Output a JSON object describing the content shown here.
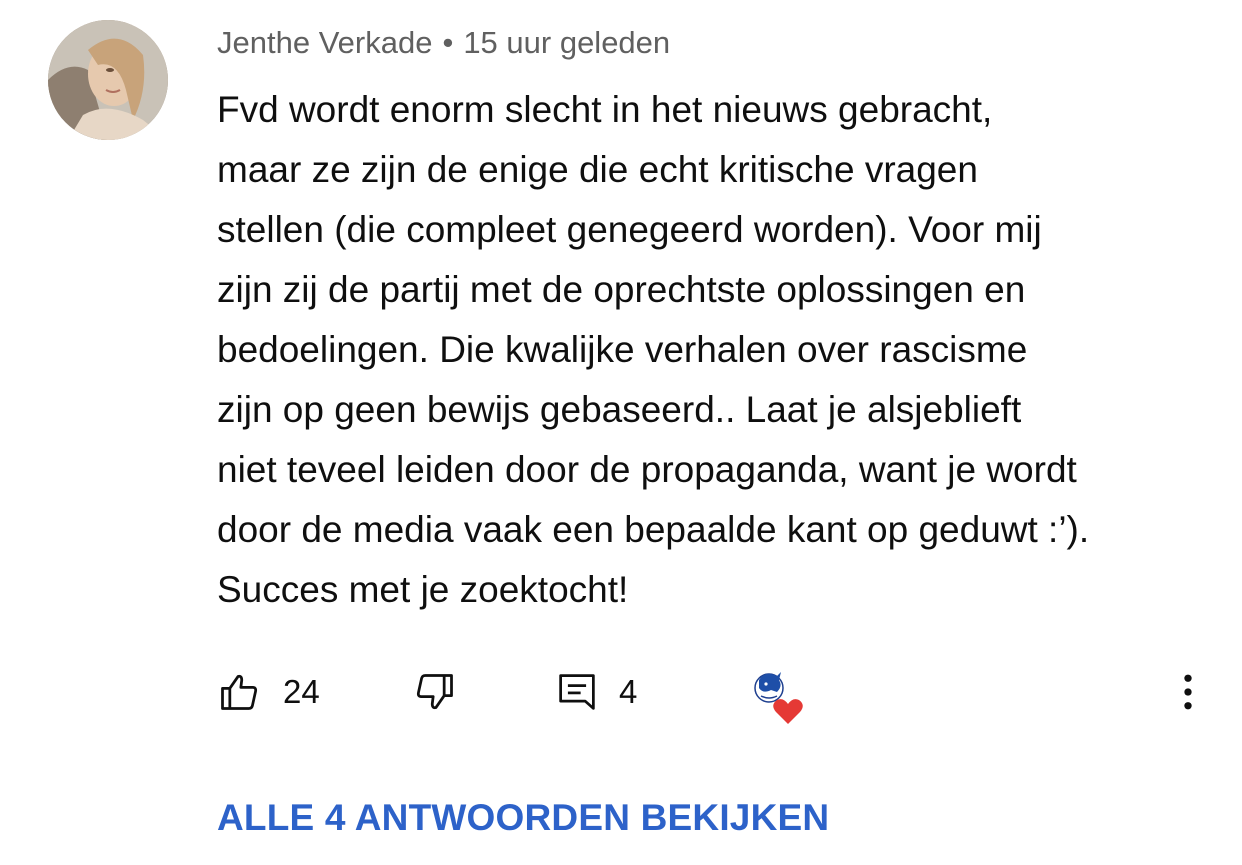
{
  "comment": {
    "author": "Jenthe Verkade",
    "separator": "•",
    "time": "15 uur geleden",
    "text_lines": [
      "Fvd wordt enorm slecht in het nieuws gebracht,",
      "maar ze zijn de enige die echt kritische vragen",
      "stellen (die compleet genegeerd worden). Voor mij",
      "zijn zij de partij met de oprechtste oplossingen en",
      "bedoelingen. Die kwalijke verhalen over rascisme",
      "zijn op geen bewijs gebaseerd.. Laat je alsjeblieft",
      "niet teveel leiden door de propaganda, want je wordt",
      "door de media vaak een bepaalde kant op geduwt :’).",
      "Succes met je zoektocht!"
    ],
    "like_count": "24",
    "reply_count": "4"
  },
  "view_replies_label": "ALLE 4 ANTWOORDEN BEKIJKEN",
  "icons": {
    "like": "thumbs-up-icon",
    "dislike": "thumbs-down-icon",
    "reply": "reply-icon",
    "creator_heart": "creator-heart-icon",
    "more": "more-vertical-icon"
  },
  "colors": {
    "link": "#2d62c9",
    "meta": "#606060",
    "heart": "#e53935",
    "text": "#0f0f0f"
  }
}
